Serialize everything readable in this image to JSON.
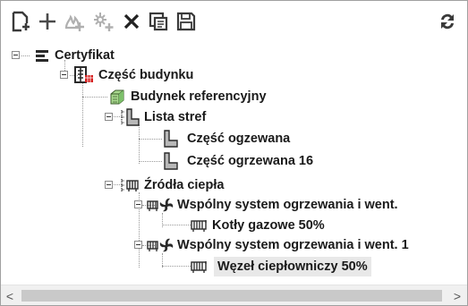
{
  "toolbar": {
    "buttons": [
      {
        "name": "new-document-icon",
        "color": "#3a3a3a"
      },
      {
        "name": "add-icon",
        "color": "#4a4a4a"
      },
      {
        "name": "add-source-icon",
        "color": "#b0b0b0"
      },
      {
        "name": "add-system-icon",
        "color": "#b0b0b0"
      },
      {
        "name": "delete-icon",
        "color": "#222222"
      },
      {
        "name": "copy-icon",
        "color": "#3a3a3a"
      },
      {
        "name": "save-icon",
        "color": "#3a3a3a"
      },
      {
        "name": "refresh-icon",
        "color": "#3a3a3a"
      }
    ]
  },
  "tree": {
    "nodes": [
      {
        "label": "Certyfikat",
        "icon": "certificate-icon"
      },
      {
        "label": "Część budynku",
        "icon": "building-part-icon"
      },
      {
        "label": "Budynek referencyjny",
        "icon": "reference-building-icon"
      },
      {
        "label": "Lista stref",
        "icon": "zone-list-icon"
      },
      {
        "label": "Część ogzewana",
        "icon": "zone-icon"
      },
      {
        "label": "Część ogrzewana 16",
        "icon": "zone-icon"
      },
      {
        "label": "Źródła ciepła",
        "icon": "heat-sources-icon"
      },
      {
        "label": "Wspólny system ogrzewania i went.",
        "icon": "heating-system-icon"
      },
      {
        "label": "Kotły gazowe 50%",
        "icon": "radiator-icon"
      },
      {
        "label": "Wspólny system ogrzewania i went. 1",
        "icon": "heating-system-icon"
      },
      {
        "label": "Węzeł ciepłowniczy 50%",
        "icon": "radiator-icon",
        "selected": true
      }
    ]
  },
  "scrollbar": {
    "left_arrow": "<",
    "right_arrow": ">"
  },
  "colors": {
    "accent_red": "#d62020",
    "zone_green": "#7cc06a"
  }
}
